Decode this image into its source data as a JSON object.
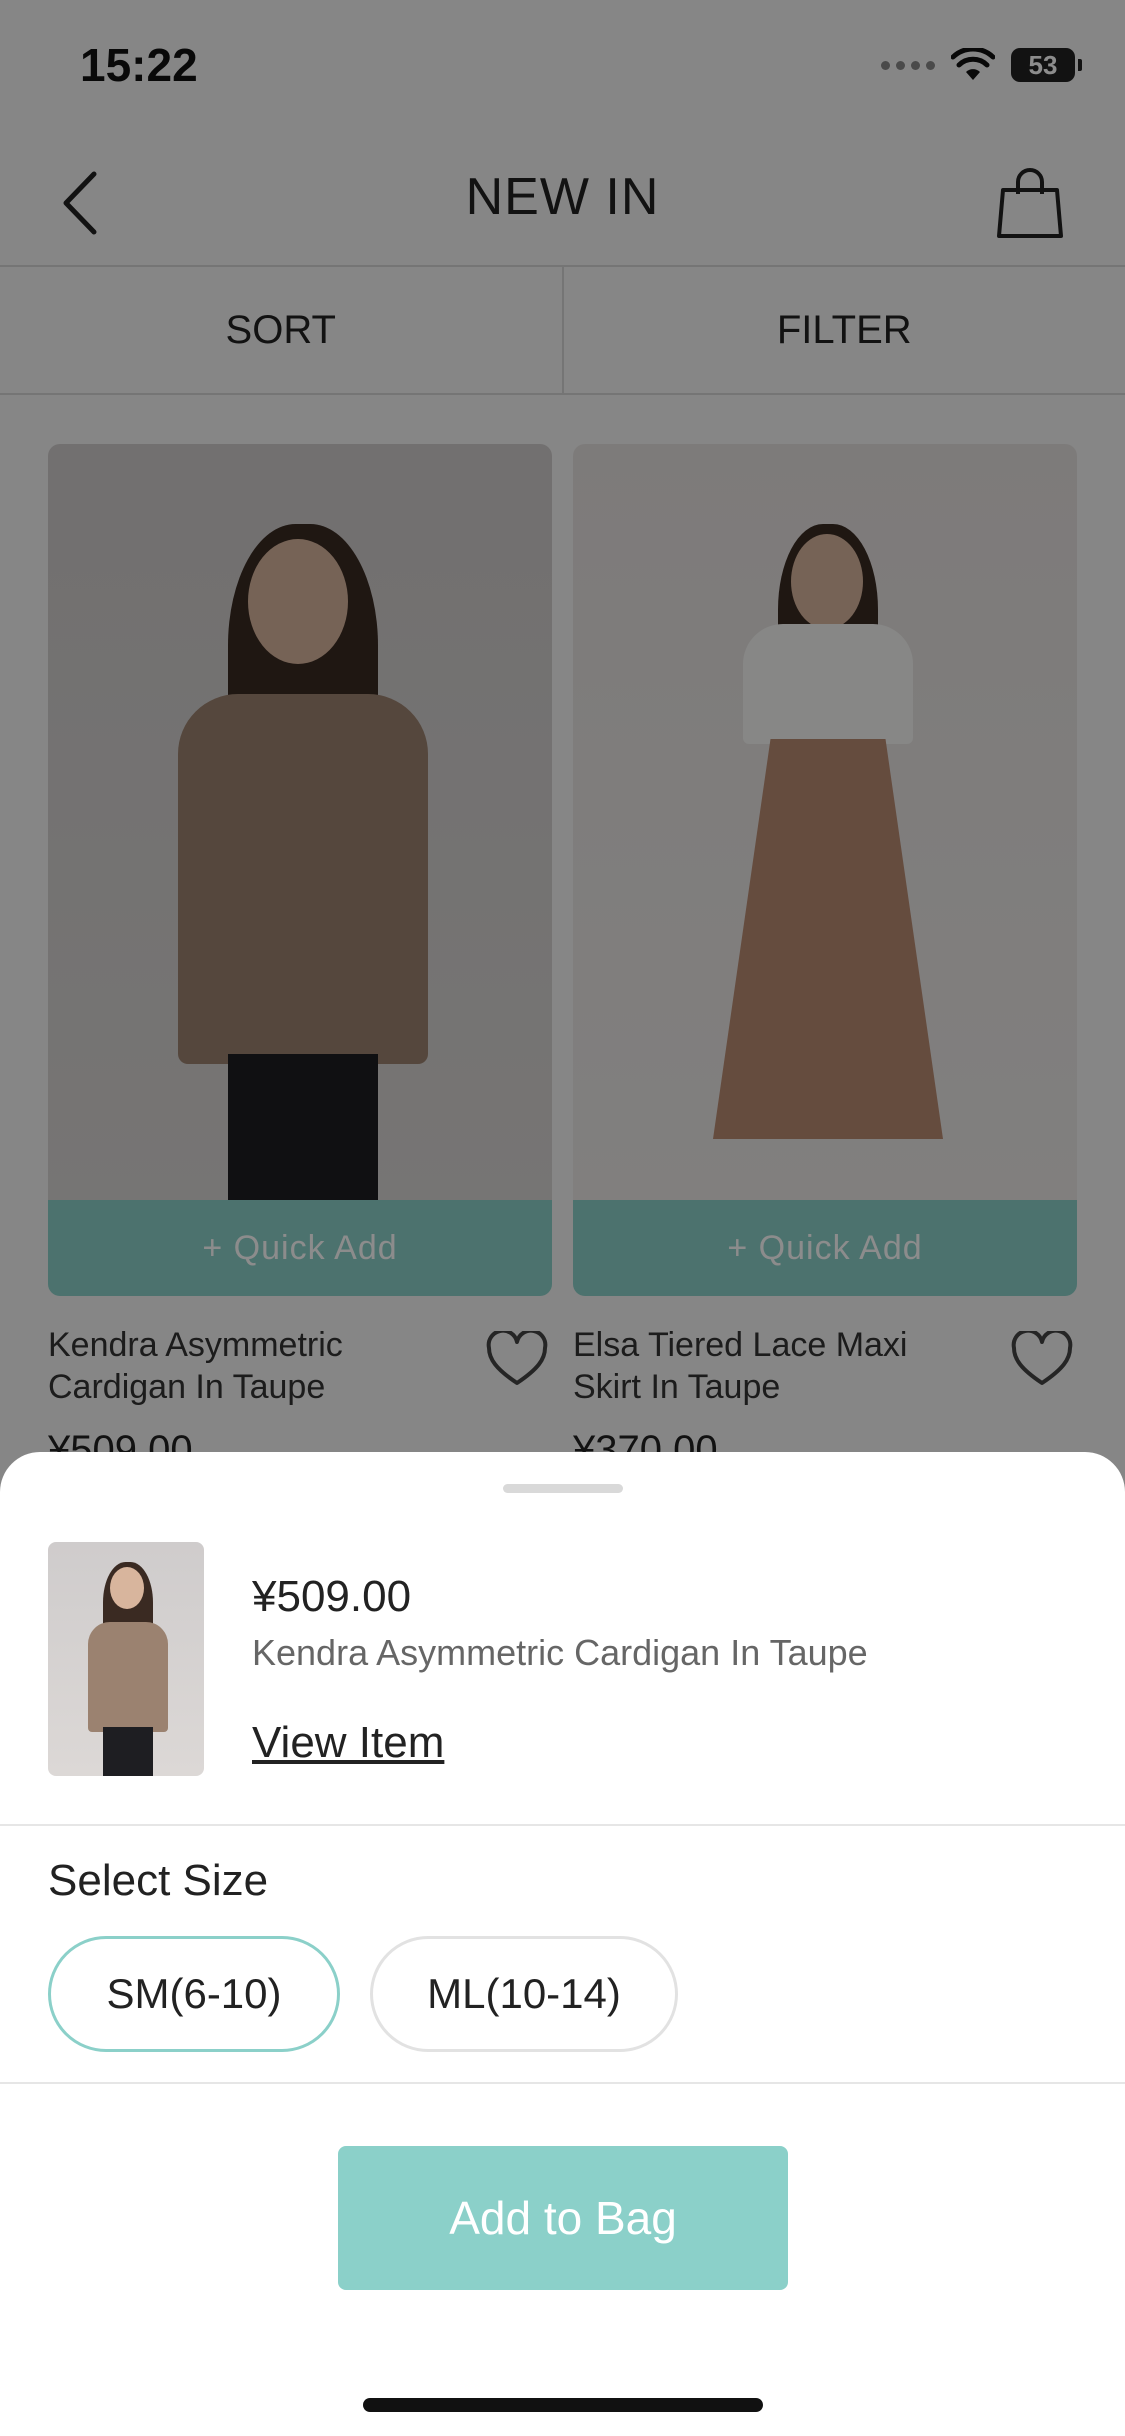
{
  "status_bar": {
    "time": "15:22",
    "battery": "53"
  },
  "nav": {
    "title": "NEW IN",
    "back_icon": "chevron-left-icon",
    "bag_icon": "shopping-bag-icon"
  },
  "toolbar": {
    "sort_label": "SORT",
    "filter_label": "FILTER"
  },
  "products": [
    {
      "name": "Kendra Asymmetric Cardigan In Taupe",
      "price": "¥509.00",
      "quick_add": "+ Quick Add"
    },
    {
      "name": "Elsa Tiered Lace Maxi Skirt In Taupe",
      "price": "¥370.00",
      "quick_add": "+ Quick Add"
    }
  ],
  "sheet": {
    "price": "¥509.00",
    "name": "Kendra Asymmetric Cardigan In Taupe",
    "view_item": "View Item",
    "select_size_label": "Select Size",
    "sizes": [
      {
        "label": "SM(6-10)",
        "selected": true
      },
      {
        "label": "ML(10-14)",
        "selected": false
      }
    ],
    "add_to_bag": "Add to Bag"
  },
  "colors": {
    "accent": "#8bd0c9",
    "text": "#222222",
    "overlay": "rgba(0,0,0,0.45)"
  }
}
